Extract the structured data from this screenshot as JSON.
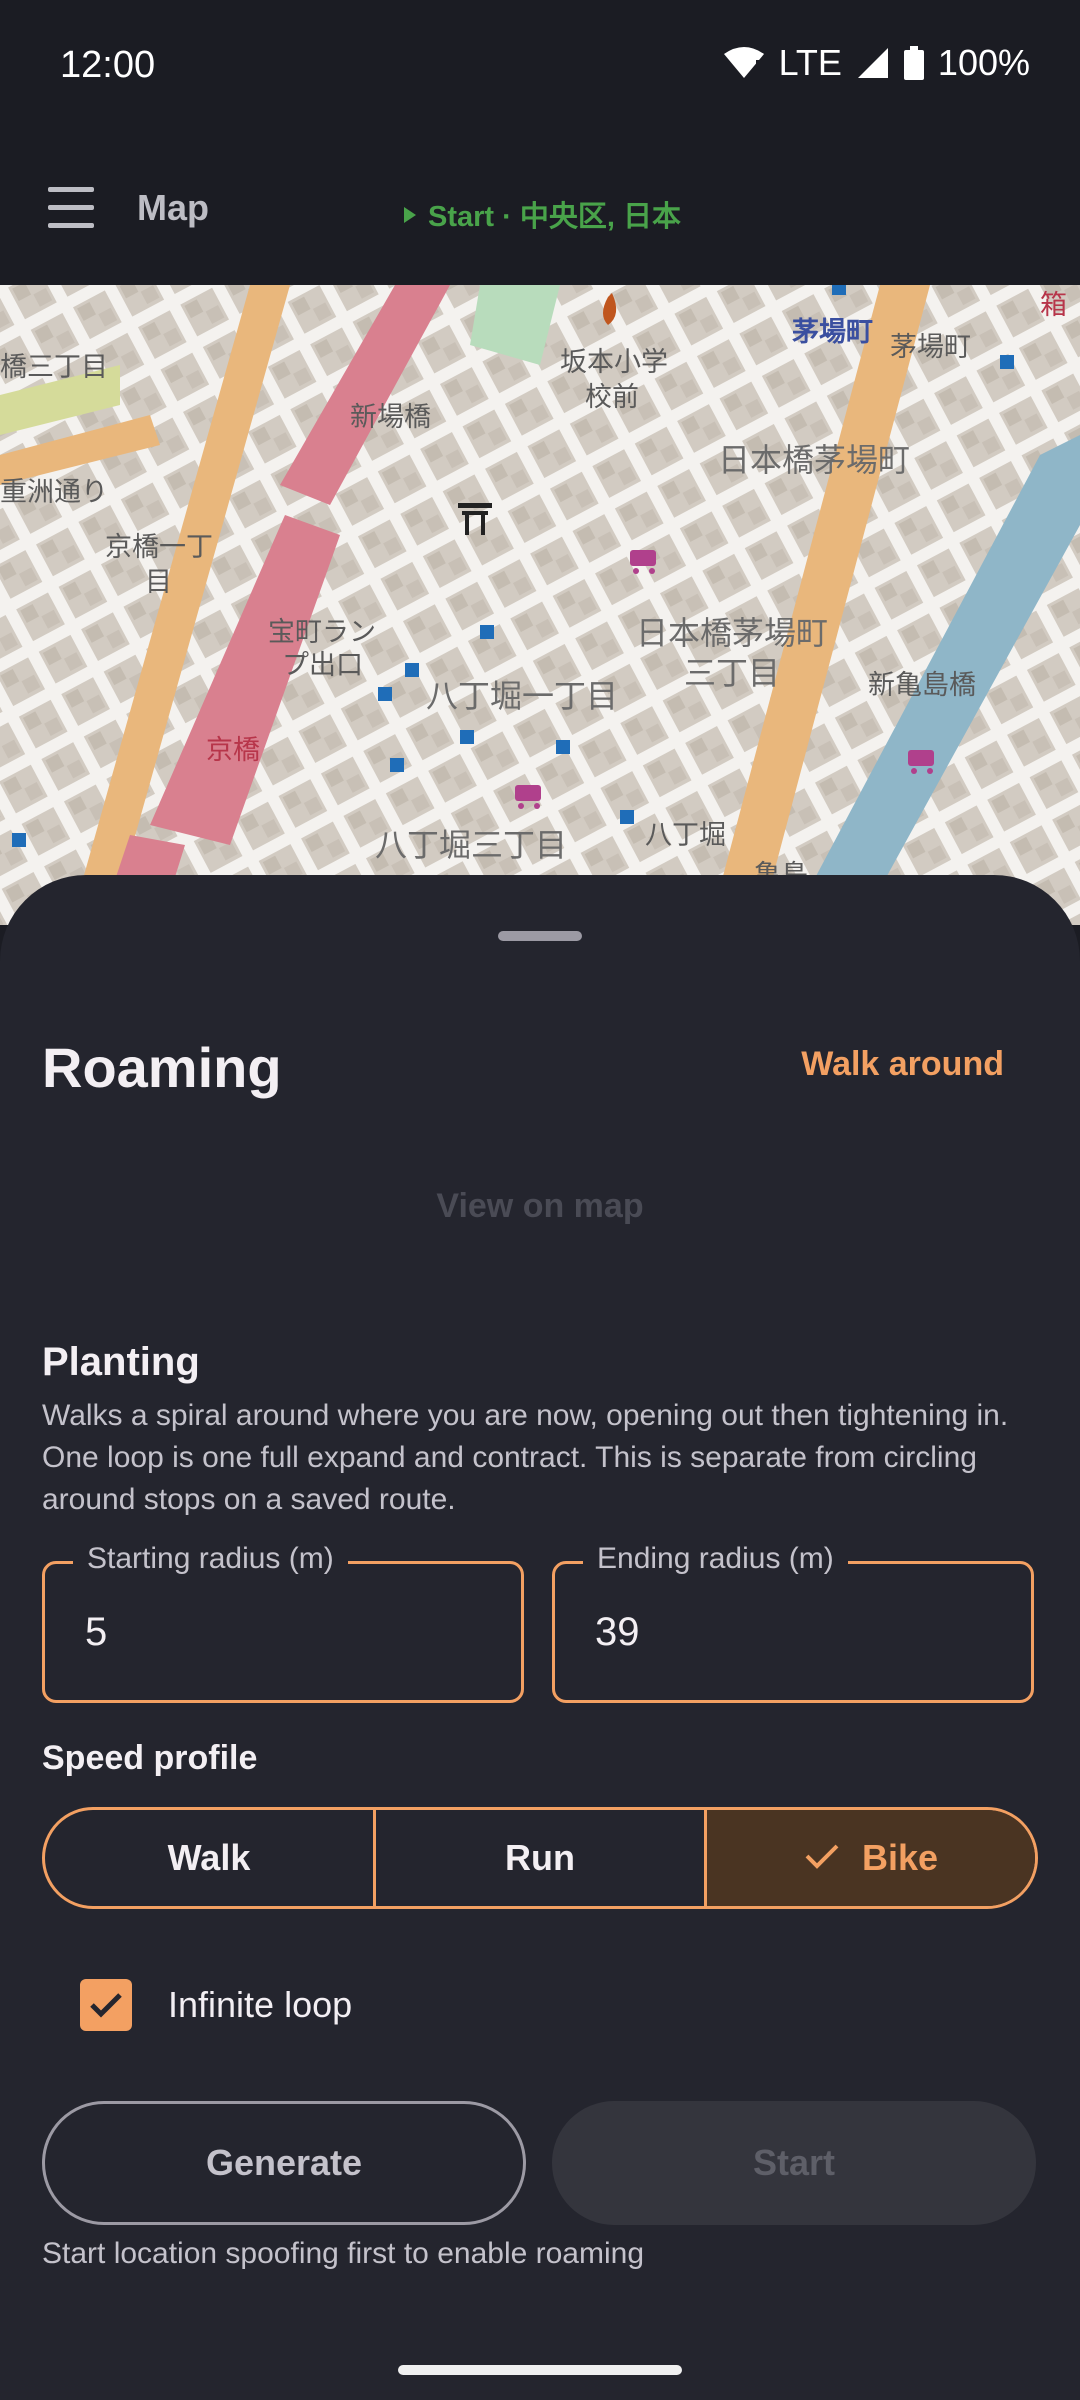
{
  "status_bar": {
    "time": "12:00",
    "network": "LTE",
    "battery": "100%"
  },
  "app_bar": {
    "title": "Map",
    "start_location": "Start · 中央区, 日本"
  },
  "map": {
    "labels": [
      {
        "text": "茅場町",
        "cls": "blue"
      },
      {
        "text": "茅場町",
        "cls": ""
      },
      {
        "text": "坂本小学",
        "cls": ""
      },
      {
        "text": "校前",
        "cls": ""
      },
      {
        "text": "日本橋茅場町",
        "cls": "big"
      },
      {
        "text": "新場橋",
        "cls": ""
      },
      {
        "text": "京橋一丁",
        "cls": ""
      },
      {
        "text": "目",
        "cls": ""
      },
      {
        "text": "宝町ラン",
        "cls": ""
      },
      {
        "text": "プ出口",
        "cls": ""
      },
      {
        "text": "日本橋茅場町",
        "cls": "big"
      },
      {
        "text": "三丁目",
        "cls": "big"
      },
      {
        "text": "新亀島橋",
        "cls": ""
      },
      {
        "text": "八丁堀一丁目",
        "cls": "big"
      },
      {
        "text": "京橋",
        "cls": "red"
      },
      {
        "text": "八丁堀",
        "cls": ""
      },
      {
        "text": "八丁堀三丁目",
        "cls": "big"
      },
      {
        "text": "亀島",
        "cls": ""
      },
      {
        "text": "橋三丁目",
        "cls": ""
      },
      {
        "text": "重洲通り",
        "cls": ""
      },
      {
        "text": "箱",
        "cls": "red"
      }
    ]
  },
  "sheet": {
    "title": "Roaming",
    "walk_around": "Walk around",
    "view_on_map": "View on map",
    "section_title": "Planting",
    "description": "Walks a spiral around where you are now, opening out then tightening in. One loop is one full expand and contract. This is separate from circling around stops on a saved route.",
    "start_radius": {
      "label": "Starting radius (m)",
      "value": "5"
    },
    "end_radius": {
      "label": "Ending radius (m)",
      "value": "39"
    },
    "speed_label": "Speed profile",
    "speed_options": [
      "Walk",
      "Run",
      "Bike"
    ],
    "selected_speed": "Bike",
    "infinite_loop": {
      "label": "Infinite loop",
      "checked": true
    },
    "generate_label": "Generate",
    "start_label": "Start",
    "hint": "Start location spoofing first to enable roaming"
  },
  "colors": {
    "accent": "#f3a062",
    "start_green": "#49a34a",
    "sheet_bg": "#24252e"
  }
}
